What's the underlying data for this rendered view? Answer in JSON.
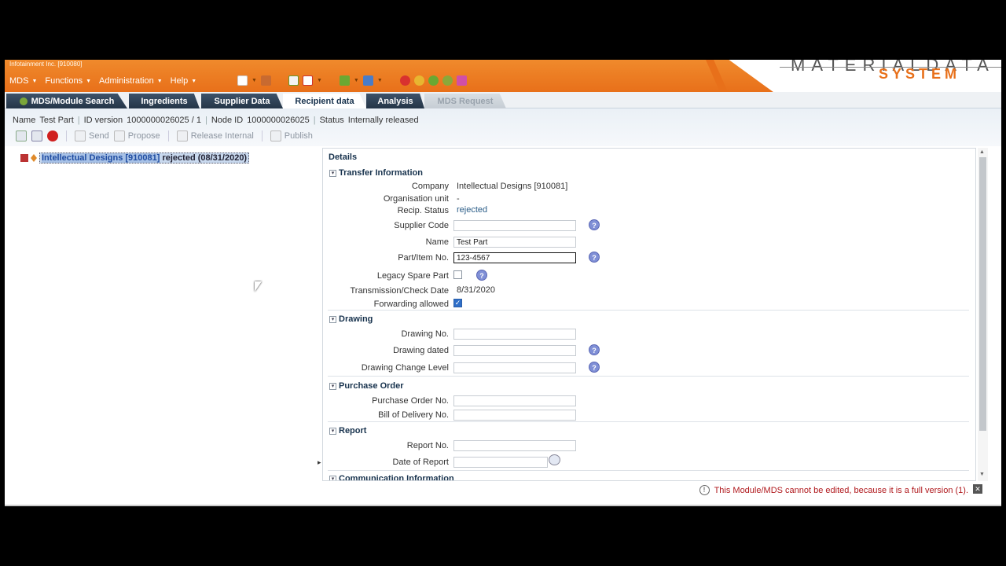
{
  "org_label": "Infotainment Inc. [910080]",
  "menu": [
    "MDS",
    "Functions",
    "Administration",
    "Help"
  ],
  "logo": {
    "top": "MATERIALDATA",
    "bottom": "SYSTEM"
  },
  "tabs": [
    "MDS/Module Search",
    "Ingredients",
    "Supplier Data",
    "Recipient data",
    "Analysis",
    "MDS Request"
  ],
  "active_tab": "Recipient data",
  "info": {
    "name_label": "Name",
    "name": "Test Part",
    "id_label": "ID version",
    "id": "1000000026025 / 1",
    "node_label": "Node ID",
    "node": "1000000026025",
    "status_label": "Status",
    "status": "Internally released"
  },
  "actions": [
    "Send",
    "Propose",
    "Release Internal",
    "Publish"
  ],
  "tree": {
    "company": "Intellectual Designs [910081]",
    "status": "rejected (08/31/2020)"
  },
  "details": {
    "title": "Details",
    "transfer": {
      "heading": "Transfer Information",
      "company_label": "Company",
      "company": "Intellectual Designs [910081]",
      "org_unit_label": "Organisation unit",
      "org_unit": "-",
      "recip_status_label": "Recip. Status",
      "recip_status": "rejected",
      "supplier_code_label": "Supplier Code",
      "supplier_code": "",
      "name_label": "Name",
      "name": "Test Part",
      "part_no_label": "Part/Item No.",
      "part_no": "123-4567",
      "legacy_label": "Legacy Spare Part",
      "transmission_label": "Transmission/Check Date",
      "transmission": "8/31/2020",
      "forwarding_label": "Forwarding allowed"
    },
    "drawing": {
      "heading": "Drawing",
      "no_label": "Drawing No.",
      "dated_label": "Drawing dated",
      "change_label": "Drawing Change Level"
    },
    "purchase": {
      "heading": "Purchase Order",
      "po_label": "Purchase Order No.",
      "bod_label": "Bill of Delivery No."
    },
    "report": {
      "heading": "Report",
      "no_label": "Report No.",
      "date_label": "Date of Report"
    },
    "communication": {
      "heading": "Communication Information"
    }
  },
  "status_message": "This Module/MDS cannot be edited, because it is a full version (1)."
}
